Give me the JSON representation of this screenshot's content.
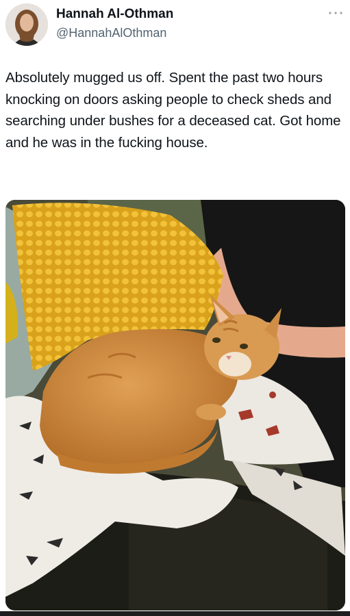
{
  "tweet": {
    "author": {
      "display_name": "Hannah Al-Othman",
      "handle": "@HannahAlOthman"
    },
    "text": "Absolutely mugged us off. Spent the past two hours knocking on doors asking people to check sheds and searching under bushes for a deceased cat. Got home and he was in the fucking house.",
    "icons": {
      "more": "more-horizontal-icon"
    },
    "colors": {
      "text": "#0f1419",
      "secondary": "#536471"
    }
  }
}
